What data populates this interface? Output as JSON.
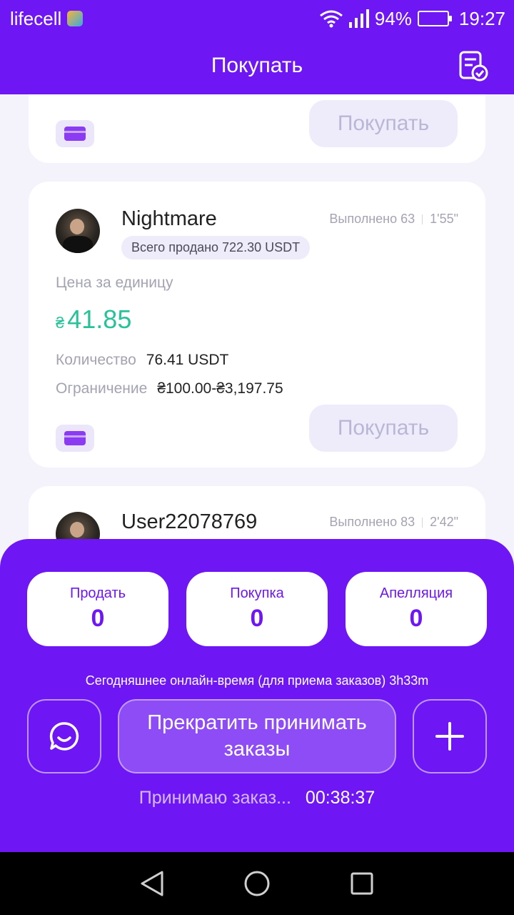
{
  "status_bar": {
    "carrier": "lifecell",
    "battery": "94%",
    "time": "19:27"
  },
  "header": {
    "title": "Покупать"
  },
  "cards": [
    {
      "buy_label": "Покупать"
    },
    {
      "name": "Nightmare",
      "completed": "Выполнено 63",
      "avg_time": "1'55\"",
      "total_sold": "Всего продано 722.30 USDT",
      "unit_price_label": "Цена за единицу",
      "currency_symbol": "₴",
      "price": "41.85",
      "quantity_label": "Количество",
      "quantity_value": "76.41 USDT",
      "limit_label": "Ограничение",
      "limit_value": "₴100.00-₴3,197.75",
      "buy_label": "Покупать"
    },
    {
      "name": "User22078769",
      "completed": "Выполнено 83",
      "avg_time": "2'42\""
    }
  ],
  "panel": {
    "counters": [
      {
        "label": "Продать",
        "value": "0"
      },
      {
        "label": "Покупка",
        "value": "0"
      },
      {
        "label": "Апелляция",
        "value": "0"
      }
    ],
    "online_text": "Сегодняшнее онлайн-время (для приема заказов) 3h33m",
    "stop_button": "Прекратить принимать заказы",
    "accepting_label": "Принимаю заказ...",
    "accepting_timer": "00:38:37"
  },
  "colors": {
    "brand": "#6e17f4",
    "price": "#27c29a"
  }
}
